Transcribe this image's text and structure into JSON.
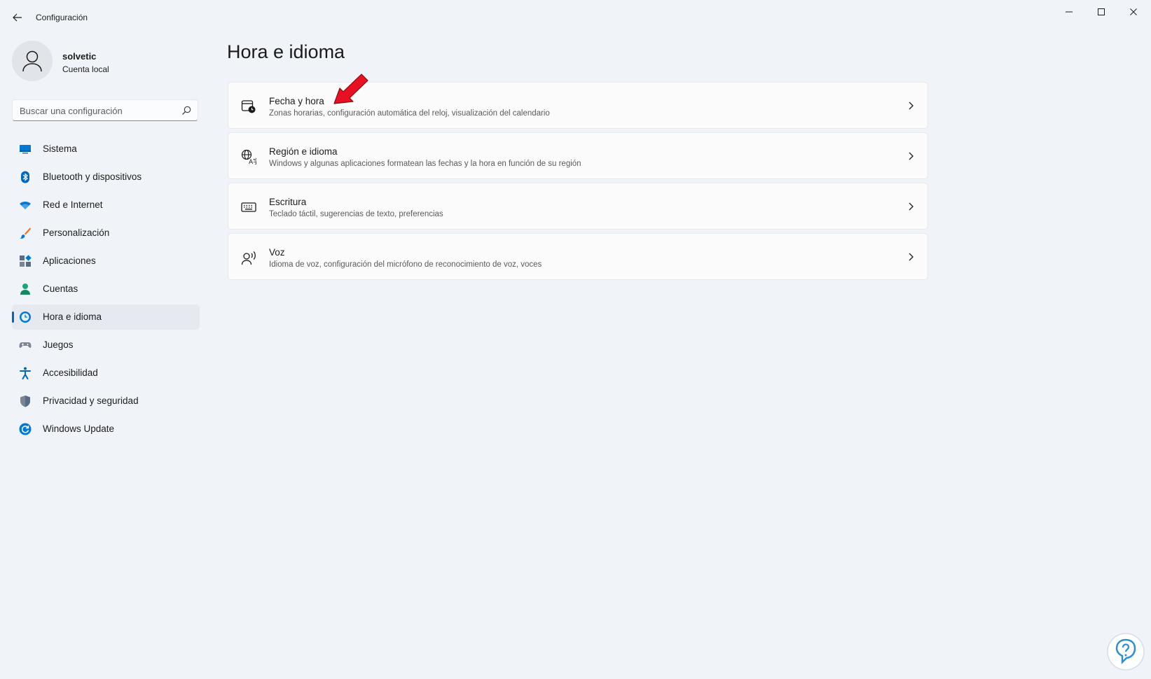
{
  "window": {
    "title": "Configuración"
  },
  "profile": {
    "name": "solvetic",
    "account_type": "Cuenta local"
  },
  "search": {
    "placeholder": "Buscar una configuración"
  },
  "sidebar": {
    "items": [
      {
        "label": "Sistema",
        "icon": "monitor-icon",
        "color": "#0078d4"
      },
      {
        "label": "Bluetooth y dispositivos",
        "icon": "bluetooth-icon",
        "color": "#0067c0"
      },
      {
        "label": "Red e Internet",
        "icon": "wifi-icon",
        "color": "#0078d4"
      },
      {
        "label": "Personalización",
        "icon": "brush-icon",
        "color": "#e8742c"
      },
      {
        "label": "Aplicaciones",
        "icon": "apps-icon",
        "color": "#5a6b86"
      },
      {
        "label": "Cuentas",
        "icon": "person-icon",
        "color": "#1aa67b"
      },
      {
        "label": "Hora e idioma",
        "icon": "globe-clock-icon",
        "color": "#0078d4",
        "active": true
      },
      {
        "label": "Juegos",
        "icon": "gamepad-icon",
        "color": "#7b8593"
      },
      {
        "label": "Accesibilidad",
        "icon": "accessibility-icon",
        "color": "#0067c0"
      },
      {
        "label": "Privacidad y seguridad",
        "icon": "shield-icon",
        "color": "#7b8593"
      },
      {
        "label": "Windows Update",
        "icon": "update-icon",
        "color": "#0078d4"
      }
    ]
  },
  "main": {
    "title": "Hora e idioma",
    "cards": [
      {
        "title": "Fecha y hora",
        "description": "Zonas horarias, configuración automática del reloj, visualización del calendario",
        "icon": "calendar-clock-icon"
      },
      {
        "title": "Región e idioma",
        "description": "Windows y algunas aplicaciones formatean las fechas y la hora en función de su región",
        "icon": "language-icon"
      },
      {
        "title": "Escritura",
        "description": "Teclado táctil, sugerencias de texto, preferencias",
        "icon": "keyboard-icon"
      },
      {
        "title": "Voz",
        "description": "Idioma de voz, configuración del micrófono de reconocimiento de voz, voces",
        "icon": "speech-icon"
      }
    ]
  },
  "colors": {
    "accent": "#0067c0",
    "background": "#f0f4f9",
    "annotation_arrow": "#e81123"
  }
}
